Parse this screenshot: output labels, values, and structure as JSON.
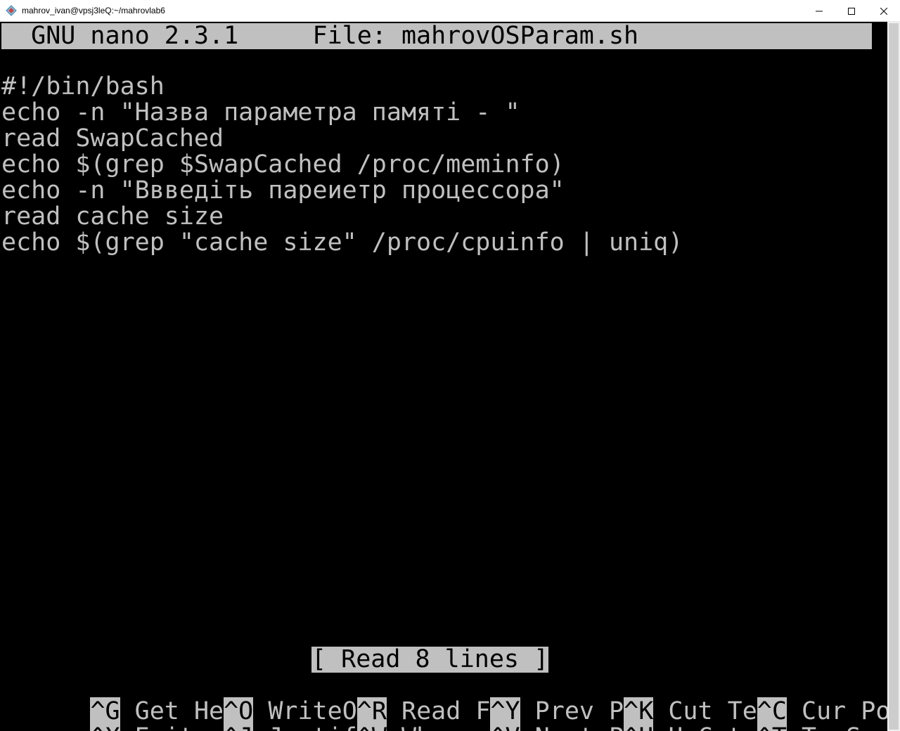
{
  "window": {
    "title": "mahrov_ivan@vpsj3leQ:~/mahrovlab6"
  },
  "nano": {
    "header": "  GNU nano 2.3.1     File: mahrovOSParam.sh",
    "lines": [
      "#!/bin/bash",
      "echo -n \"Назва параметра памяті - \"",
      "read SwapCached",
      "echo $(grep $SwapCached /proc/meminfo)",
      "echo -n \"Ввведіть пареиетр процессора\"",
      "read cache size",
      "echo $(grep \"cache size\" /proc/cpuinfo | uniq)"
    ],
    "status": "[ Read 8 lines ]",
    "shortcuts_row1": [
      {
        "key": "^G",
        "label": " Get He"
      },
      {
        "key": "^O",
        "label": " WriteO"
      },
      {
        "key": "^R",
        "label": " Read F"
      },
      {
        "key": "^Y",
        "label": " Prev P"
      },
      {
        "key": "^K",
        "label": " Cut Te"
      },
      {
        "key": "^C",
        "label": " Cur Pos"
      }
    ],
    "shortcuts_row2": [
      {
        "key": "^X",
        "label": " Exit  "
      },
      {
        "key": "^J",
        "label": " Justif"
      },
      {
        "key": "^W",
        "label": " Where "
      },
      {
        "key": "^V",
        "label": " Next P"
      },
      {
        "key": "^U",
        "label": " UnCut "
      },
      {
        "key": "^T",
        "label": " To Spell"
      }
    ]
  },
  "colors": {
    "terminal_bg": "#000000",
    "terminal_fg": "#c0c0c0",
    "highlight_bg": "#c0c0c0"
  }
}
